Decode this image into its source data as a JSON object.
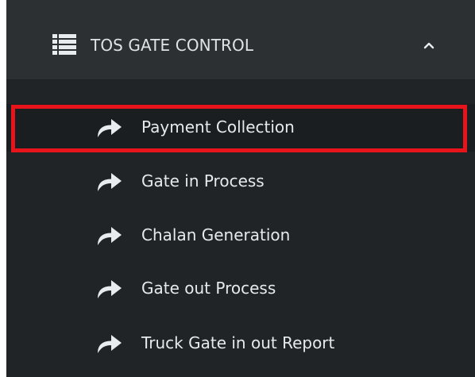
{
  "menu": {
    "title": "TOS GATE CONTROL",
    "header_icon": "list-icon",
    "collapse_icon": "chevron-up-icon",
    "item_icon": "share-arrow-icon",
    "items": [
      {
        "label": "Payment Collection",
        "active": true
      },
      {
        "label": "Gate in Process"
      },
      {
        "label": "Chalan Generation"
      },
      {
        "label": "Gate out Process"
      },
      {
        "label": "Truck Gate in out Report"
      }
    ]
  },
  "highlight": {
    "color": "#e8141b",
    "target": "Payment Collection"
  },
  "colors": {
    "panel_bg": "#26292c",
    "submenu_bg": "#212427",
    "text": "#e7eaed",
    "icon": "#e9ecef"
  }
}
